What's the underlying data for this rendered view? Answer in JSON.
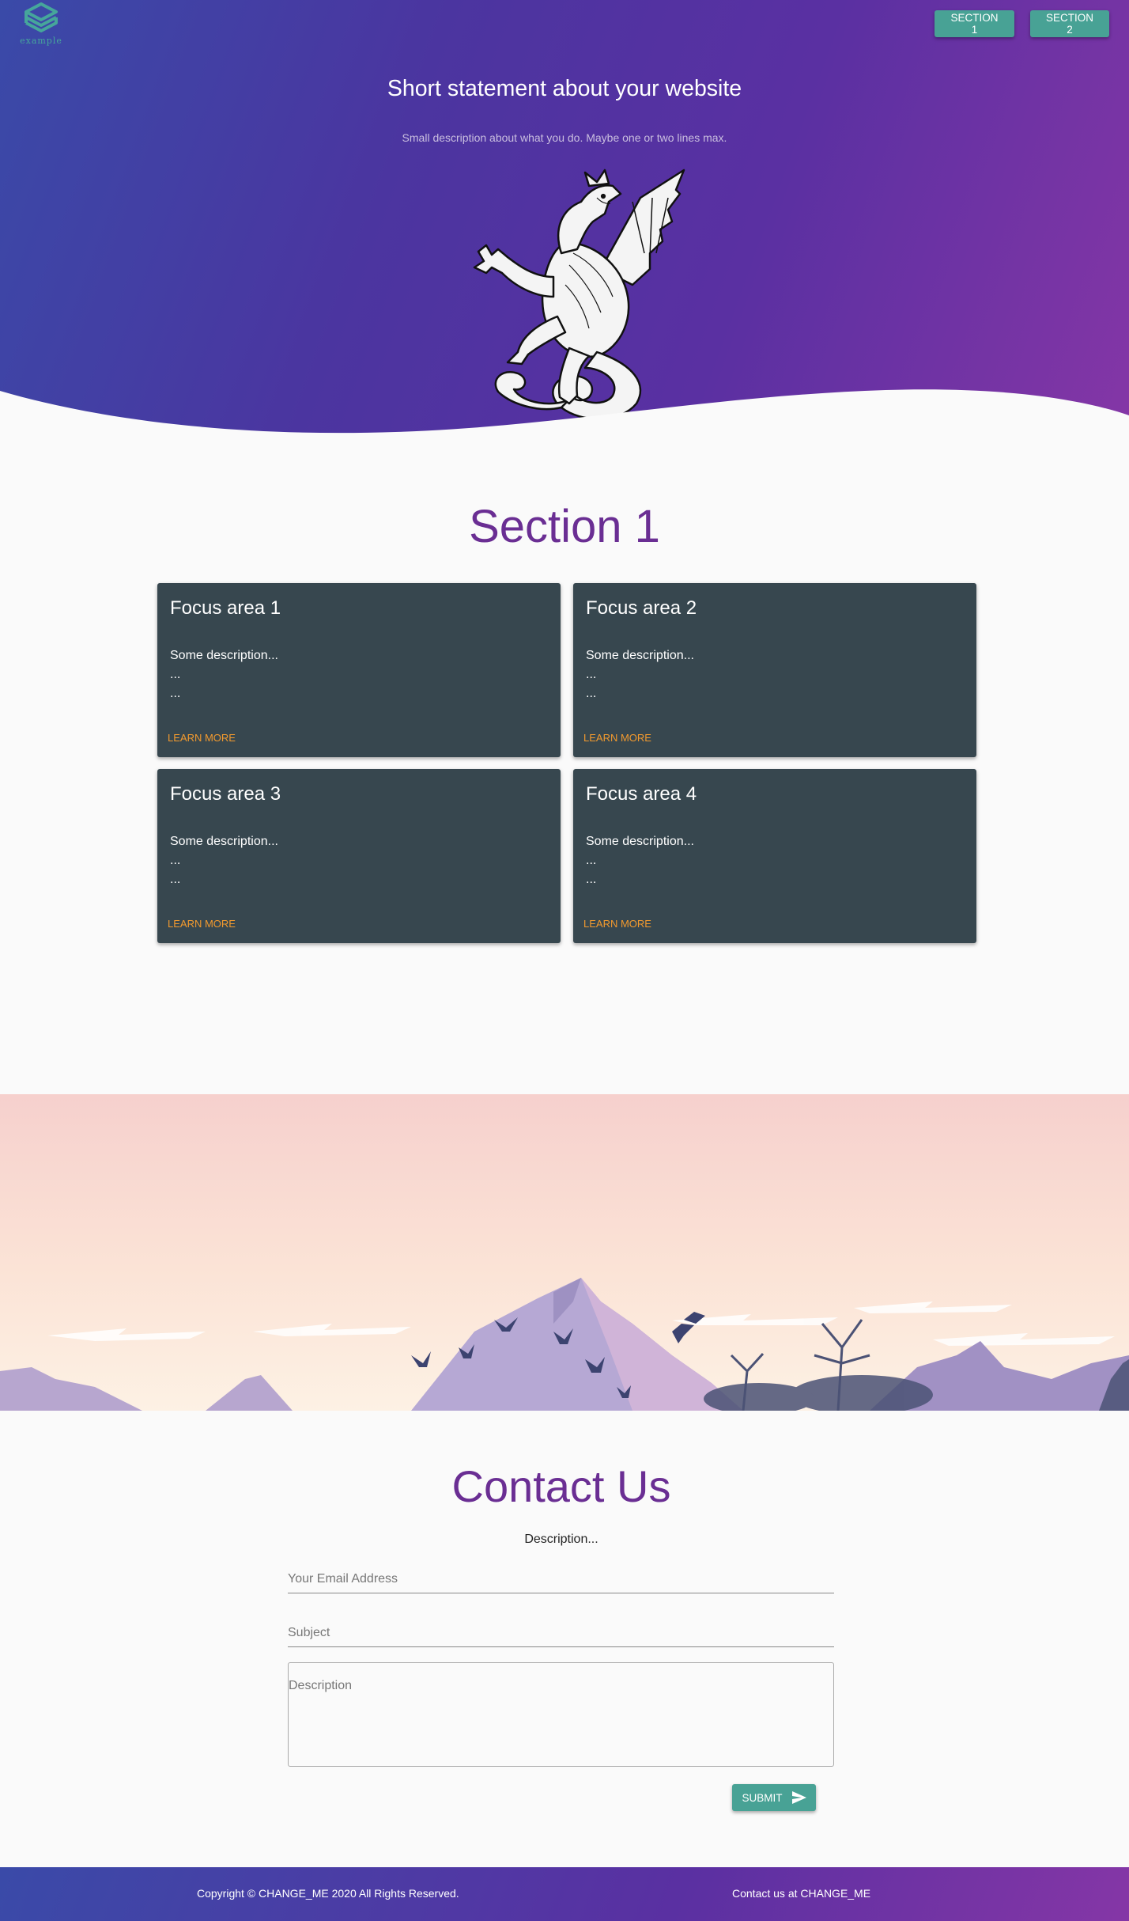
{
  "colors": {
    "hero_gradient_start": "#3a4aa8",
    "hero_gradient_end": "#8536a6",
    "accent_teal": "#48a295",
    "heading_purple": "#6a2e93",
    "card_bg": "#37474f",
    "link_orange": "#f29a2e"
  },
  "header": {
    "logo_icon": "cube-logo-icon",
    "logo_text": "example",
    "nav": [
      {
        "label": "SECTION 1"
      },
      {
        "label": "SECTION 2"
      }
    ]
  },
  "hero": {
    "title": "Short statement about your website",
    "subtitle": "Small description about what you do. Maybe one or two lines max.",
    "image_icon": "dragon-illustration"
  },
  "section1": {
    "title": "Section 1",
    "cards": [
      {
        "title": "Focus area 1",
        "lines": [
          "Some description...",
          "...",
          "..."
        ],
        "link": "LEARN MORE"
      },
      {
        "title": "Focus area 2",
        "lines": [
          "Some description...",
          "...",
          "..."
        ],
        "link": "LEARN MORE"
      },
      {
        "title": "Focus area 3",
        "lines": [
          "Some description...",
          "...",
          "..."
        ],
        "link": "LEARN MORE"
      },
      {
        "title": "Focus area 4",
        "lines": [
          "Some description...",
          "...",
          "..."
        ],
        "link": "LEARN MORE"
      }
    ]
  },
  "banner": {
    "image_icon": "mountain-landscape-illustration"
  },
  "contact": {
    "title": "Contact Us",
    "description": "Description...",
    "email_placeholder": "Your Email Address",
    "subject_placeholder": "Subject",
    "description_placeholder": "Description",
    "submit_label": "SUBMIT",
    "submit_icon": "send-icon"
  },
  "footer": {
    "copyright": "Copyright © CHANGE_ME 2020 All Rights Reserved.",
    "contact": "Contact us at CHANGE_ME"
  }
}
